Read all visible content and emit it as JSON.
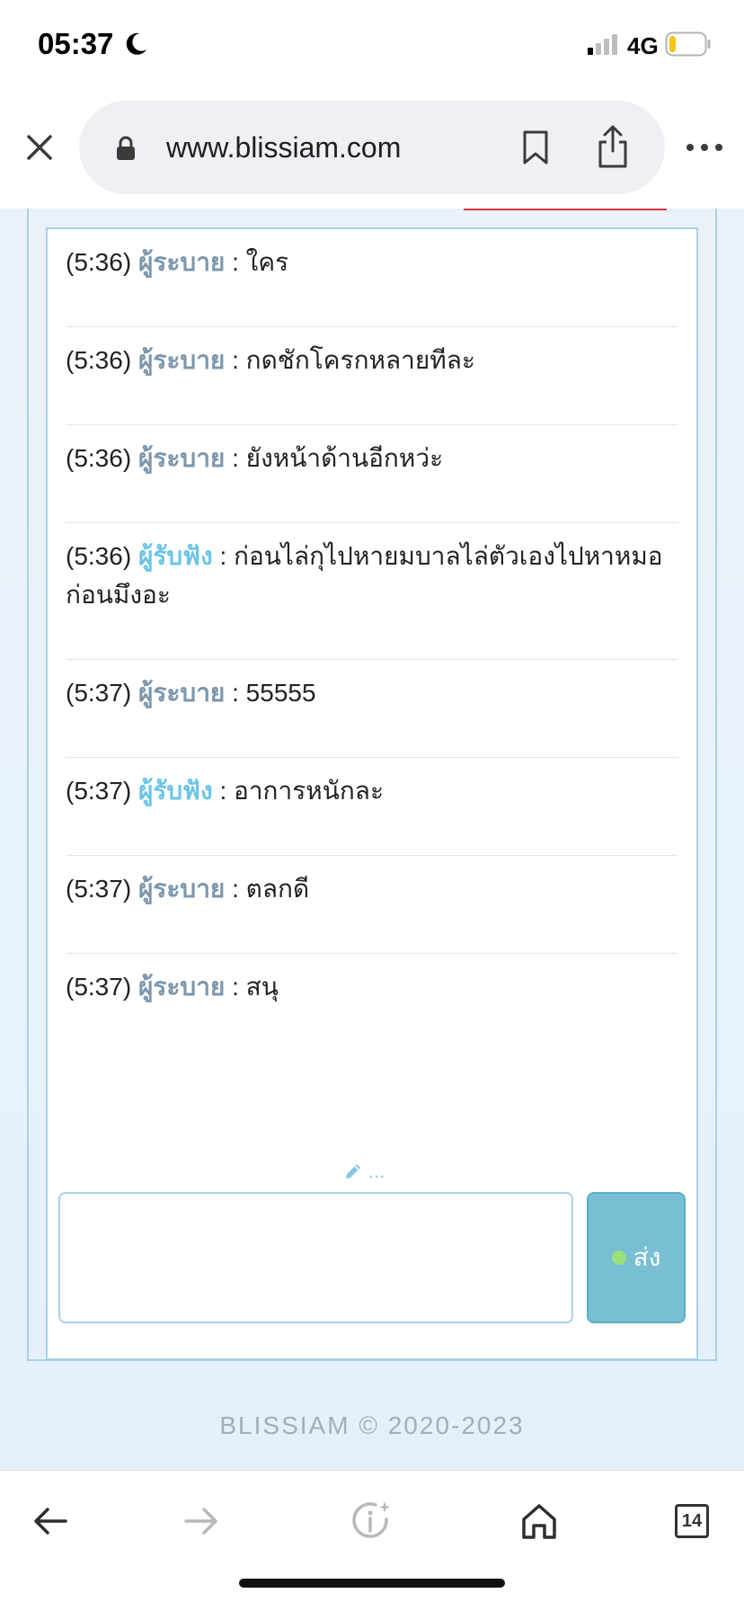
{
  "status_bar": {
    "time": "05:37",
    "network": "4G"
  },
  "browser": {
    "url": "www.blissiam.com"
  },
  "chat": {
    "messages": [
      {
        "time": "(5:36)",
        "role": "ผู้ระบาย",
        "role_type": "teller",
        "text": "ใคร"
      },
      {
        "time": "(5:36)",
        "role": "ผู้ระบาย",
        "role_type": "teller",
        "text": "กดชักโครกหลายทีละ"
      },
      {
        "time": "(5:36)",
        "role": "ผู้ระบาย",
        "role_type": "teller",
        "text": "ยังหน้าด้านอีกหว่ะ"
      },
      {
        "time": "(5:36)",
        "role": "ผู้รับฟัง",
        "role_type": "listener",
        "text": "ก่อนไล่กุไปหายมบาลไล่ตัวเองไปหาหมอก่อนมึงอะ"
      },
      {
        "time": "(5:37)",
        "role": "ผู้ระบาย",
        "role_type": "teller",
        "text": "55555"
      },
      {
        "time": "(5:37)",
        "role": "ผู้รับฟัง",
        "role_type": "listener",
        "text": "อาการหนักละ"
      },
      {
        "time": "(5:37)",
        "role": "ผู้ระบาย",
        "role_type": "teller",
        "text": "ตลกดี"
      },
      {
        "time": "(5:37)",
        "role": "ผู้ระบาย",
        "role_type": "teller",
        "text": "สนุ"
      }
    ],
    "separator": ":",
    "typing_indicator": "...",
    "input_value": "",
    "send_label": "ส่ง"
  },
  "footer": {
    "copyright": "BLISSIAM © 2020-2023"
  },
  "toolbar": {
    "tab_count": "14"
  },
  "colors": {
    "teller_role": "#7d97ad",
    "listener_role": "#6bc5e8",
    "send_button": "#78bfd4",
    "border": "#a9d3e4"
  },
  "icons": [
    "moon-icon",
    "signal-icon",
    "battery-icon",
    "close-icon",
    "lock-icon",
    "bookmark-icon",
    "share-icon",
    "more-icon",
    "pencil-icon",
    "back-arrow-icon",
    "forward-arrow-icon",
    "info-icon",
    "home-icon",
    "tabs-icon"
  ]
}
